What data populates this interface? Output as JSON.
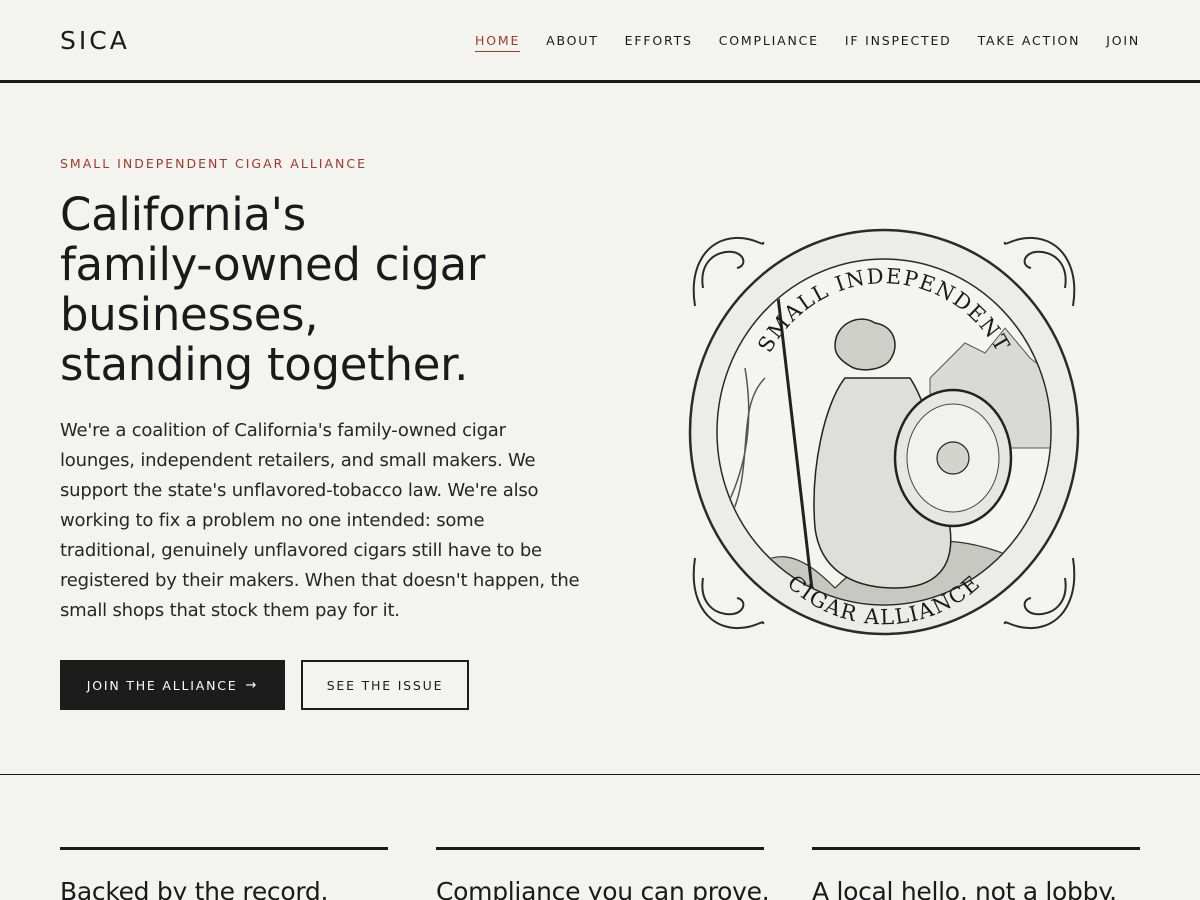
{
  "header": {
    "logo": "SICA",
    "nav": [
      {
        "label": "HOME",
        "active": true
      },
      {
        "label": "ABOUT"
      },
      {
        "label": "EFFORTS"
      },
      {
        "label": "COMPLIANCE"
      },
      {
        "label": "IF INSPECTED"
      },
      {
        "label": "TAKE ACTION"
      },
      {
        "label": "JOIN"
      }
    ]
  },
  "hero": {
    "eyebrow": "SMALL INDEPENDENT CIGAR ALLIANCE",
    "title_lines": [
      "California's",
      "family-owned cigar",
      "businesses,",
      "standing together."
    ],
    "body": "We're a coalition of California's family-owned cigar lounges, independent retailers, and small makers. We support the state's unflavored-tobacco law. We're also working to fix a problem no one intended: some traditional, genuinely unflavored cigars still have to be registered by their makers. When that doesn't happen, the small shops that stock them pay for it.",
    "primary_button": "JOIN THE ALLIANCE",
    "primary_button_icon": "arrow-right-icon",
    "secondary_button": "SEE THE ISSUE"
  },
  "seal": {
    "top_text": "SMALL INDEPENDENT",
    "bottom_text": "CIGAR ALLIANCE"
  },
  "features": [
    {
      "title": "Backed by the record."
    },
    {
      "title": "Compliance you can prove."
    },
    {
      "title": "A local hello, not a lobby."
    }
  ],
  "colors": {
    "accent": "#a03a2a",
    "ink": "#1a1a1a",
    "background": "#f3f3ef"
  }
}
